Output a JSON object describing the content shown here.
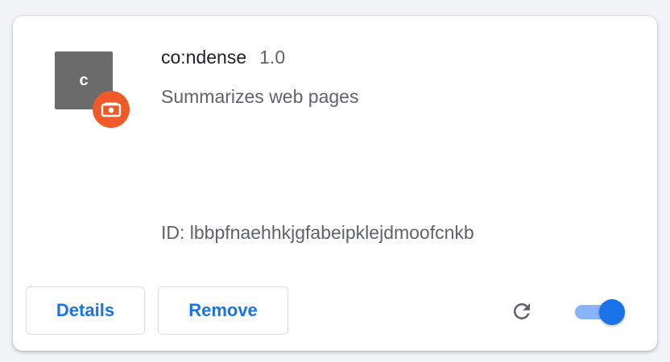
{
  "extension": {
    "icon_letter": "c",
    "name": "co:ndense",
    "version": "1.0",
    "description": "Summarizes web pages",
    "id_text": "ID: lbbpfnaehhkjgfabeipklejdmoofcnkb",
    "enabled": true
  },
  "actions": {
    "details_label": "Details",
    "remove_label": "Remove"
  },
  "icons": {
    "badge": "unpacked-extension-badge-icon",
    "reload": "reload-icon"
  },
  "colors": {
    "accent": "#1a73e8",
    "toggle_track": "#8ab4f8",
    "badge": "#f05a28",
    "icon_bg": "#6b6b6b"
  }
}
